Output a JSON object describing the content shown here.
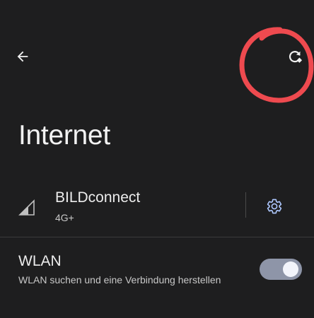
{
  "header": {
    "back_icon": "arrow-left-icon",
    "refresh_icon": "refresh-icon"
  },
  "page": {
    "title": "Internet"
  },
  "mobile_network": {
    "name": "BILDconnect",
    "type": "4G+",
    "signal_icon": "signal-icon",
    "settings_icon": "gear-icon"
  },
  "wlan": {
    "title": "WLAN",
    "subtitle": "WLAN suchen und eine Verbindung herstellen",
    "enabled": true
  },
  "colors": {
    "background": "#1e1e1f",
    "annotation": "#ee4a4f",
    "toggle_track": "#8e95a8",
    "toggle_knob": "#f2f4fb"
  }
}
